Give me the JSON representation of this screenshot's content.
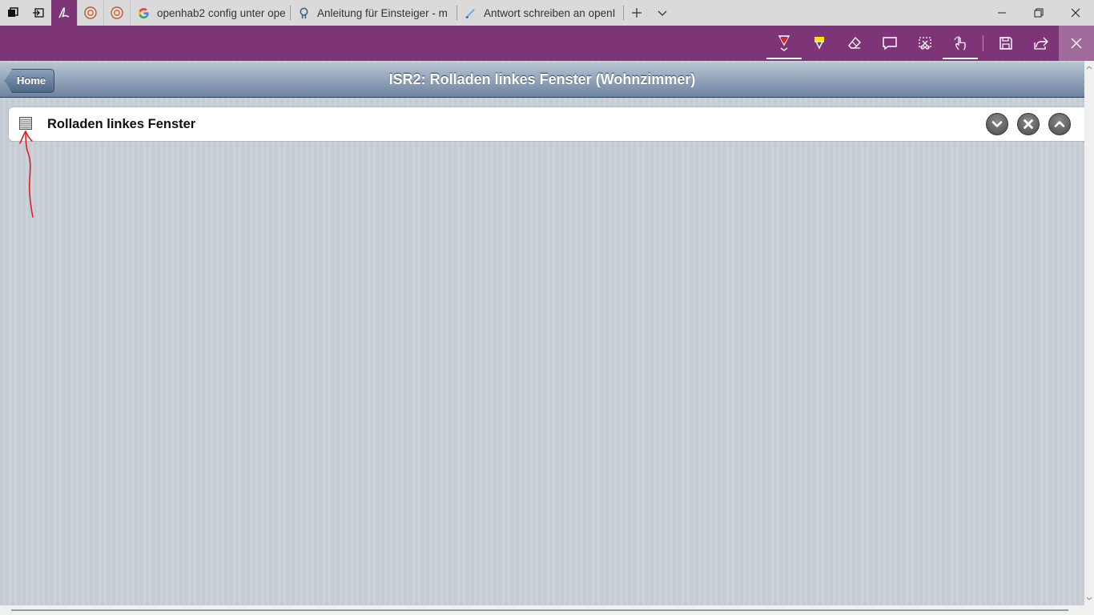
{
  "browser": {
    "tabs": [
      {
        "title": "openhab2 config unter ope"
      },
      {
        "title": "Anleitung für Einsteiger - m"
      },
      {
        "title": "Antwort schreiben an openI"
      }
    ]
  },
  "page": {
    "home_label": "Home",
    "title": "ISR2: Rolladen linkes Fenster (Wohnzimmer)",
    "item": {
      "label": "Rolladen linkes Fenster"
    }
  },
  "colors": {
    "ink_toolbar": "#7e3578",
    "header_gradient_top": "#b8c4d2",
    "header_gradient_bottom": "#6d84a2",
    "annotation_pen": "#e02020",
    "highlighter": "#ffe600"
  },
  "icons": {
    "tabbar": [
      "task-view-icon",
      "set-aside-tabs-icon",
      "ink-pen-icon",
      "openhab-icon",
      "openhab-icon",
      "google-icon",
      "forum-icon",
      "compose-icon",
      "new-tab-icon",
      "tab-preview-icon"
    ],
    "window": [
      "minimize-icon",
      "restore-icon",
      "close-icon"
    ],
    "ink_toolbar": [
      "ballpoint-pen-icon",
      "highlighter-icon",
      "eraser-icon",
      "add-note-icon",
      "clip-icon",
      "touch-writing-icon",
      "save-icon",
      "share-icon",
      "exit-icon"
    ],
    "item_controls": [
      "chevron-down-icon",
      "stop-icon",
      "chevron-up-icon"
    ]
  }
}
